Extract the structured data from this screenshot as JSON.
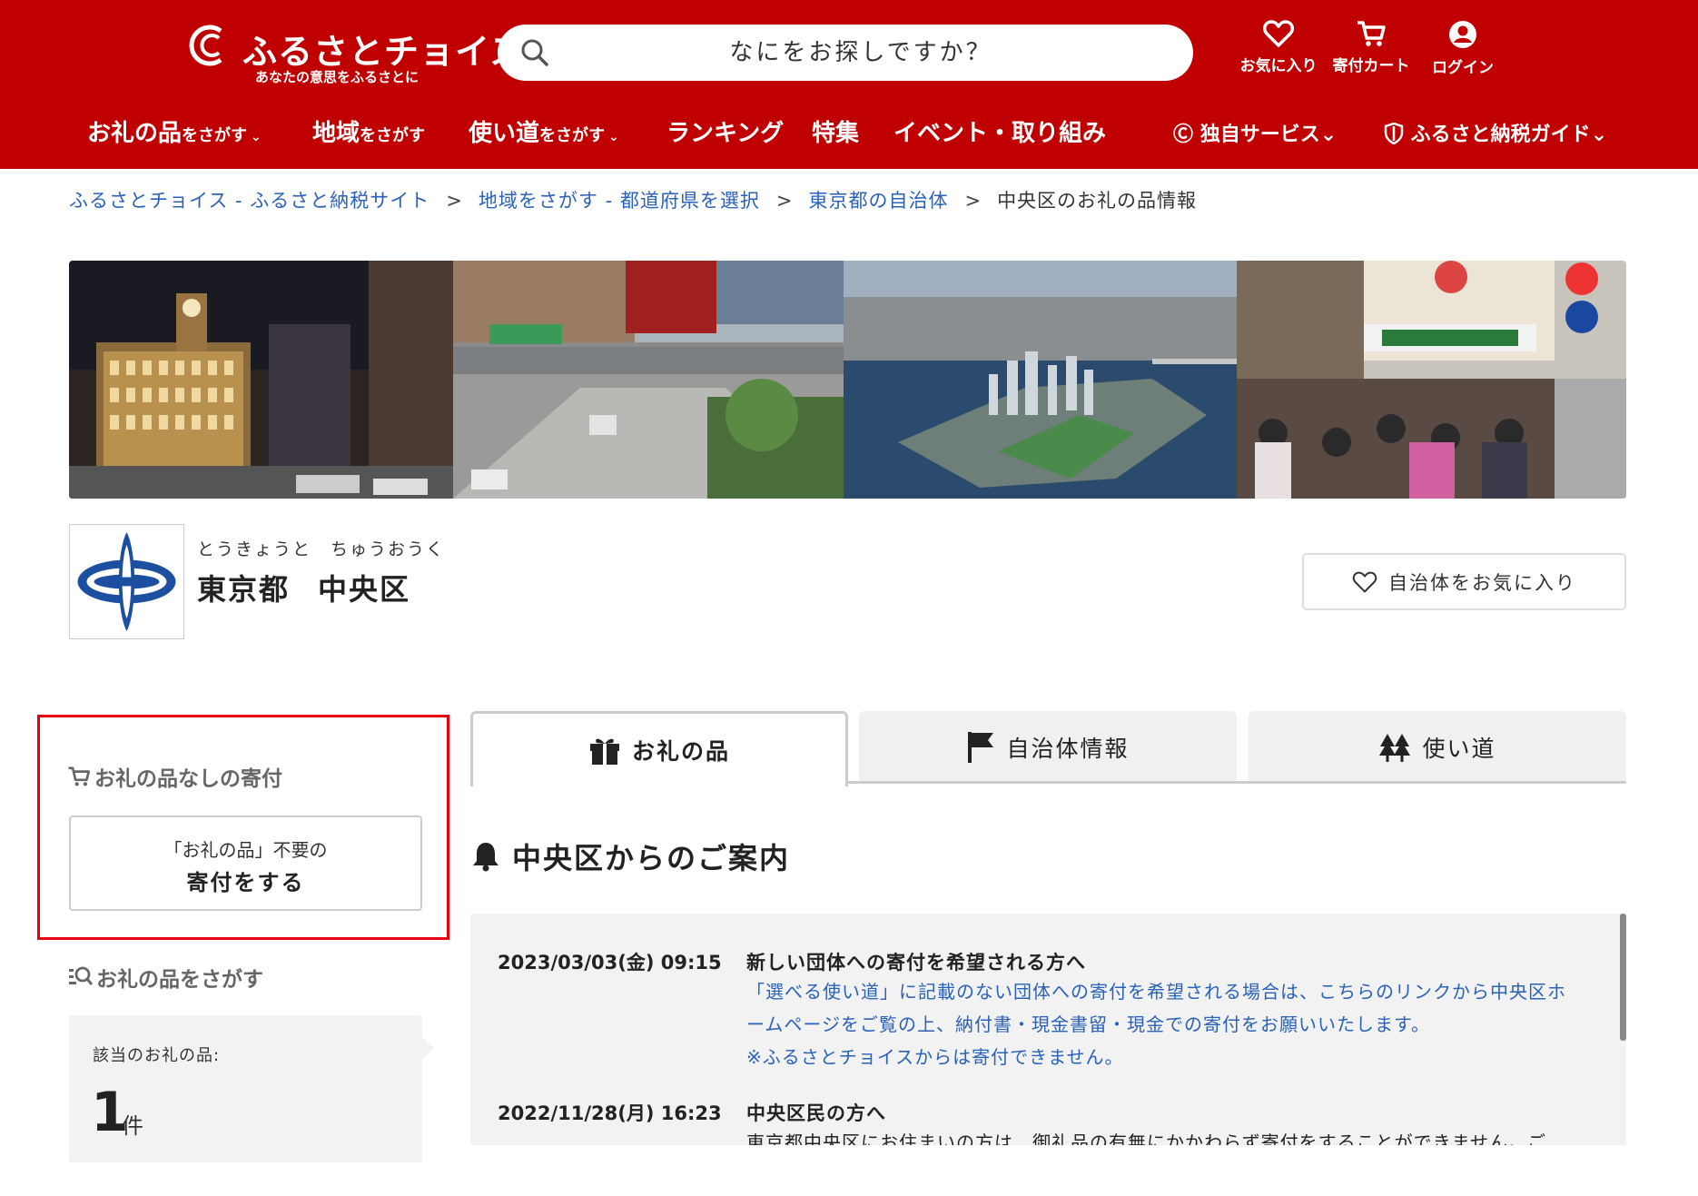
{
  "header": {
    "logo_text": "ふるさとチョイス",
    "logo_tagline": "あなたの意思をふるさとに",
    "search_placeholder": "なにをお探しですか？",
    "favorites_label": "お気に入り",
    "cart_label": "寄付カート",
    "login_label": "ログイン",
    "bg_color": "#c00000"
  },
  "nav": {
    "items": [
      {
        "main": "お礼の品",
        "sub": "をさがす"
      },
      {
        "main": "地域",
        "sub": "をさがす"
      },
      {
        "main": "使い道",
        "sub": "をさがす"
      },
      {
        "main": "ランキング"
      },
      {
        "main": "特集"
      },
      {
        "main": "イベント・取り組み"
      }
    ],
    "original_service": "独自サービス",
    "guide": "ふるさと納税ガイド"
  },
  "breadcrumb": {
    "items": [
      "ふるさとチョイス - ふるさと納税サイト",
      "地域をさがす - 都道府県を選択",
      "東京都の自治体"
    ],
    "separator": ">",
    "current": "中央区のお礼の品情報"
  },
  "municipality": {
    "prefecture_ruby": "とうきょうと",
    "city_ruby": "ちゅうおうく",
    "prefecture": "東京都",
    "city": "中央区",
    "favorite_button": "自治体をお気に入り"
  },
  "left_panel": {
    "no_gift_title": "お礼の品なしの寄付",
    "donate_line1": "「お礼の品」不要の",
    "donate_line2": "寄付をする",
    "search_title": "お礼の品をさがす",
    "count_label": "該当のお礼の品:",
    "count_value": "1",
    "count_unit": "件"
  },
  "tabs": [
    {
      "label": "お礼の品",
      "icon": "gift-icon",
      "active": true
    },
    {
      "label": "自治体情報",
      "icon": "flag-icon",
      "active": false
    },
    {
      "label": "使い道",
      "icon": "trees-icon",
      "active": false
    }
  ],
  "notices": {
    "title": "中央区からのご案内",
    "items": [
      {
        "datetime": "2023/03/03(金) 09:15",
        "title": "新しい団体への寄付を希望される方へ",
        "body_line1": "「選べる使い道」に記載のない団体への寄付を希望される場合は、こちらのリンクから中央区ホ",
        "body_line2": "ームページをご覧の上、納付書・現金書留・現金での寄付をお願いいたします。",
        "body_line3": "※ふるさとチョイスからは寄付できません。"
      },
      {
        "datetime": "2022/11/28(月) 16:23",
        "title": "中央区民の方へ",
        "body_line1": "東京都中央区にお住まいの方は、御礼品の有無にかかわらず寄付をすることができません。ご"
      }
    ]
  },
  "colors": {
    "brand_red": "#c00000",
    "link_blue": "#2a62b8",
    "highlight_red": "#e60012"
  }
}
